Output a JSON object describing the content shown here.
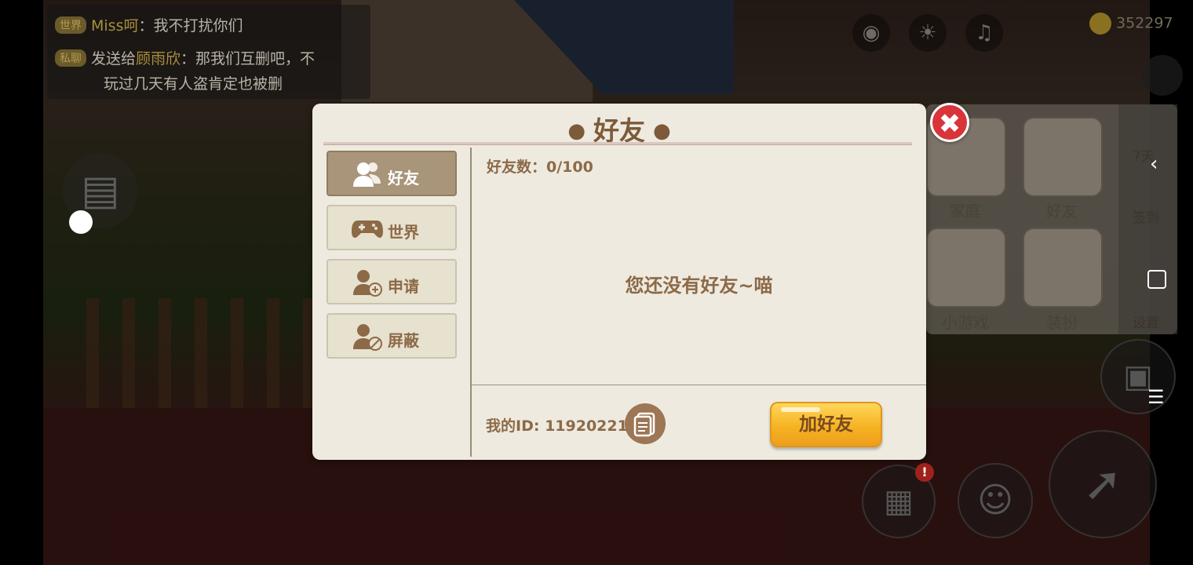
{
  "chat": {
    "line1": {
      "tag": "世界",
      "name": "Miss呵",
      "text": "：我不打扰你们"
    },
    "line2": {
      "tag": "私聊",
      "prefix": "发送给",
      "name": "顾雨欣",
      "text": "：那我们互删吧，不"
    },
    "line3": {
      "text": "玩过几天有人盗肯定也被删"
    }
  },
  "currency": {
    "amount": "352297"
  },
  "right_panel": {
    "family": "家庭",
    "friends": "好友",
    "minigame": "小游戏",
    "dressup": "装扮",
    "checkin": "签到",
    "settings": "设置",
    "level": "7天"
  },
  "dialog": {
    "title": "好友",
    "tabs": [
      "好友",
      "世界",
      "申请",
      "屏蔽"
    ],
    "friend_count_label": "好友数：0/100",
    "empty_message": "您还没有好友~喵",
    "my_id_label": "我的ID:",
    "my_id_value": "11920221",
    "add_friend_button": "加好友",
    "close_symbol": "✖"
  },
  "colors": {
    "dialog_bg": "#eeeae0",
    "accent_brown": "#8c6a47",
    "active_tab": "#a8957a",
    "close_red": "#d8343a",
    "button_gold": "#f5b323"
  }
}
